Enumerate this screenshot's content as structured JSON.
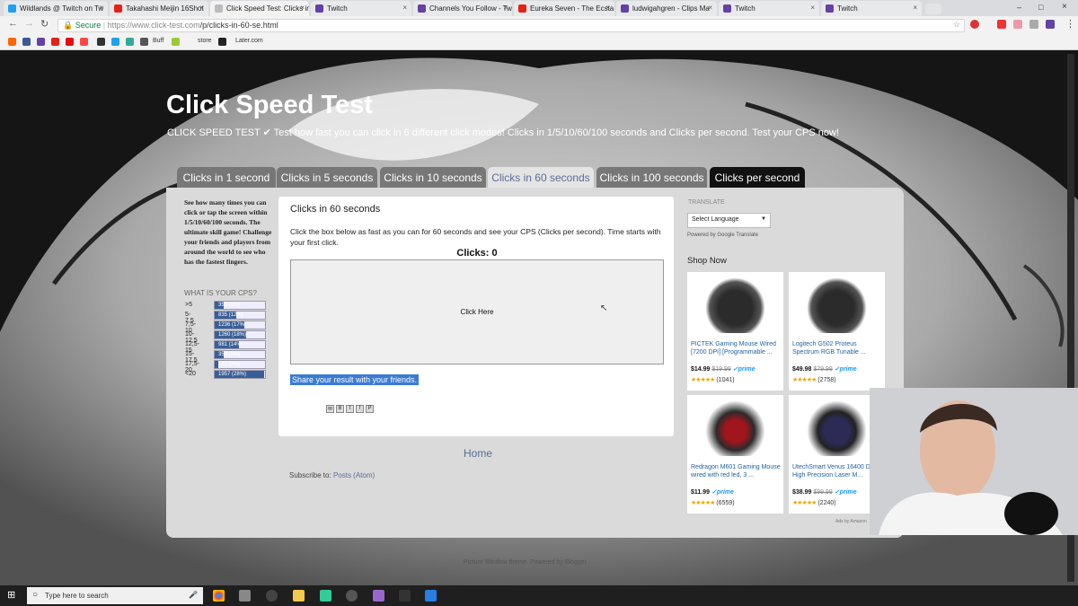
{
  "browser": {
    "tabs": [
      {
        "title": "Wildlands @ Twitch on Tw",
        "active": false
      },
      {
        "title": "Takahashi Meijin 16Shot",
        "active": false
      },
      {
        "title": "Click Speed Test: Clicks in",
        "active": true
      },
      {
        "title": "Twitch",
        "active": false
      },
      {
        "title": "Channels You Follow - Tw",
        "active": false
      },
      {
        "title": "Eureka Seven - The Ecsta",
        "active": false
      },
      {
        "title": "ludwigahgren - Clips Ma",
        "active": false
      },
      {
        "title": "Twitch",
        "active": false
      },
      {
        "title": "Twitch",
        "active": false
      }
    ],
    "secure_label": "Secure",
    "url_host": "https://www.click-test.com",
    "url_path": "/p/clicks-in-60-se.html",
    "bookmarks": [
      "Buff",
      "store",
      "Later.com"
    ]
  },
  "site": {
    "title": "Click Speed Test",
    "description": "CLICK SPEED TEST ✔ Test how fast you can click in 6 different click modes! Clicks in 1/5/10/60/100 seconds and Clicks per second. Test your CPS now!",
    "tabs": [
      "Clicks in 1 second",
      "Clicks in 5 seconds",
      "Clicks in 10 seconds",
      "Clicks in 60 seconds",
      "Clicks in 100 seconds",
      "Clicks per second"
    ],
    "selected_tab": "Clicks in 60 seconds"
  },
  "sidebar_left": {
    "intro": "See how many times you can click or tap the screen within 1/5/10/60/100 seconds. The ultimate skill game! Challenge your friends and players from around the world to see who has the fastest fingers.",
    "poll_title": "WHAT IS YOUR CPS?",
    "poll": [
      {
        "label": ">5",
        "votes": "355 (5%)",
        "pct": 5
      },
      {
        "label": "5-7,5",
        "votes": "835 (12%)",
        "pct": 12
      },
      {
        "label": "7,5-10",
        "votes": "1236 (17%)",
        "pct": 17
      },
      {
        "label": "10-12,5",
        "votes": "1260 (18%)",
        "pct": 18
      },
      {
        "label": "12,5-15",
        "votes": "981 (14%)",
        "pct": 14
      },
      {
        "label": "15-17,5",
        "votes": "359 (5%)",
        "pct": 5
      },
      {
        "label": "17,5-20",
        "votes": "142 (2%)",
        "pct": 2
      },
      {
        "label": "<20",
        "votes": "1957 (28%)",
        "pct": 28
      }
    ]
  },
  "game": {
    "heading": "Clicks in 60 seconds",
    "instructions": "Click the box below as fast as you can for 60 seconds and see your CPS (Clicks per second). Time starts with your first click.",
    "clicks_label": "Clicks: 0",
    "click_box_label": "Click Here",
    "share_label": "Share your result with your friends.",
    "home_link": "Home",
    "subscribe_prefix": "Subscribe to:",
    "subscribe_link": "Posts (Atom)"
  },
  "sidebar_right": {
    "translate_label": "TRANSLATE",
    "language_select": "Select Language",
    "powered_by": "Powered by Google Translate",
    "shop_now": "Shop Now",
    "products": [
      {
        "name": "PICTEK Gaming Mouse Wired [7200 DPI] [Programmable ...",
        "price": "$14.99",
        "old_price": "$19.99",
        "prime": "✓prime",
        "reviews": "(1041)"
      },
      {
        "name": "Logitech G502 Proteus Spectrum RGB Tunable ...",
        "price": "$49.98",
        "old_price": "$79.99",
        "prime": "✓prime",
        "reviews": "(2758)"
      },
      {
        "name": "Redragon M601 Gaming Mouse wired with red led, 3 ...",
        "price": "$11.99",
        "old_price": "",
        "prime": "✓prime",
        "reviews": "(6559)"
      },
      {
        "name": "UtechSmart Venus 16400 DPI High Precision Laser M...",
        "price": "$38.99",
        "old_price": "$99.99",
        "prime": "✓prime",
        "reviews": "(2240)"
      }
    ],
    "ads_label": "Ads by Amazon"
  },
  "footer": "Picture Window theme. Powered by Blogger.",
  "taskbar": {
    "search_placeholder": "Type here to search"
  },
  "colors": {
    "accent": "#5a6f95",
    "poll_bar": "#3a5f98",
    "share_highlight": "#3a7bd5",
    "prime": "#1a98ff"
  }
}
